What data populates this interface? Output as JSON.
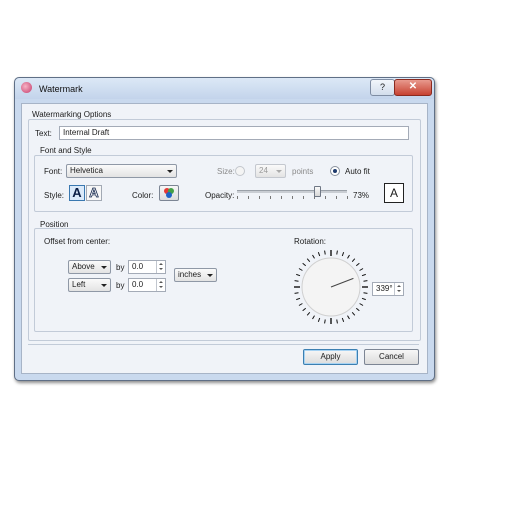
{
  "window": {
    "title": "Watermark",
    "help_label": "?",
    "close_label": "✕"
  },
  "options": {
    "group_label": "Watermarking Options",
    "text_label": "Text:",
    "text_value": "Internal Draft"
  },
  "font": {
    "group_label": "Font and Style",
    "font_label": "Font:",
    "font_value": "Helvetica",
    "size_label": "Size:",
    "size_value": "24",
    "points_label": "points",
    "autofit_label": "Auto fit",
    "style_label": "Style:",
    "style_filled": "A",
    "style_outline": "A",
    "color_label": "Color:",
    "opacity_label": "Opacity:",
    "opacity_value": "73%",
    "opacity_fraction": 0.73,
    "preview_letter": "A"
  },
  "position": {
    "group_label": "Position",
    "offset_label": "Offset from center:",
    "vertical_dir": "Above",
    "vertical_by": "by",
    "vertical_value": "0.0",
    "horizontal_dir": "Left",
    "horizontal_by": "by",
    "horizontal_value": "0.0",
    "unit": "inches",
    "rotation_label": "Rotation:",
    "rotation_value": "339°",
    "rotation_degrees": 339
  },
  "buttons": {
    "apply": "Apply",
    "cancel": "Cancel"
  },
  "colors": {
    "titlebar": "#c3d4eb",
    "close": "#c74131",
    "dialog_bg": "#f0f3f8"
  }
}
